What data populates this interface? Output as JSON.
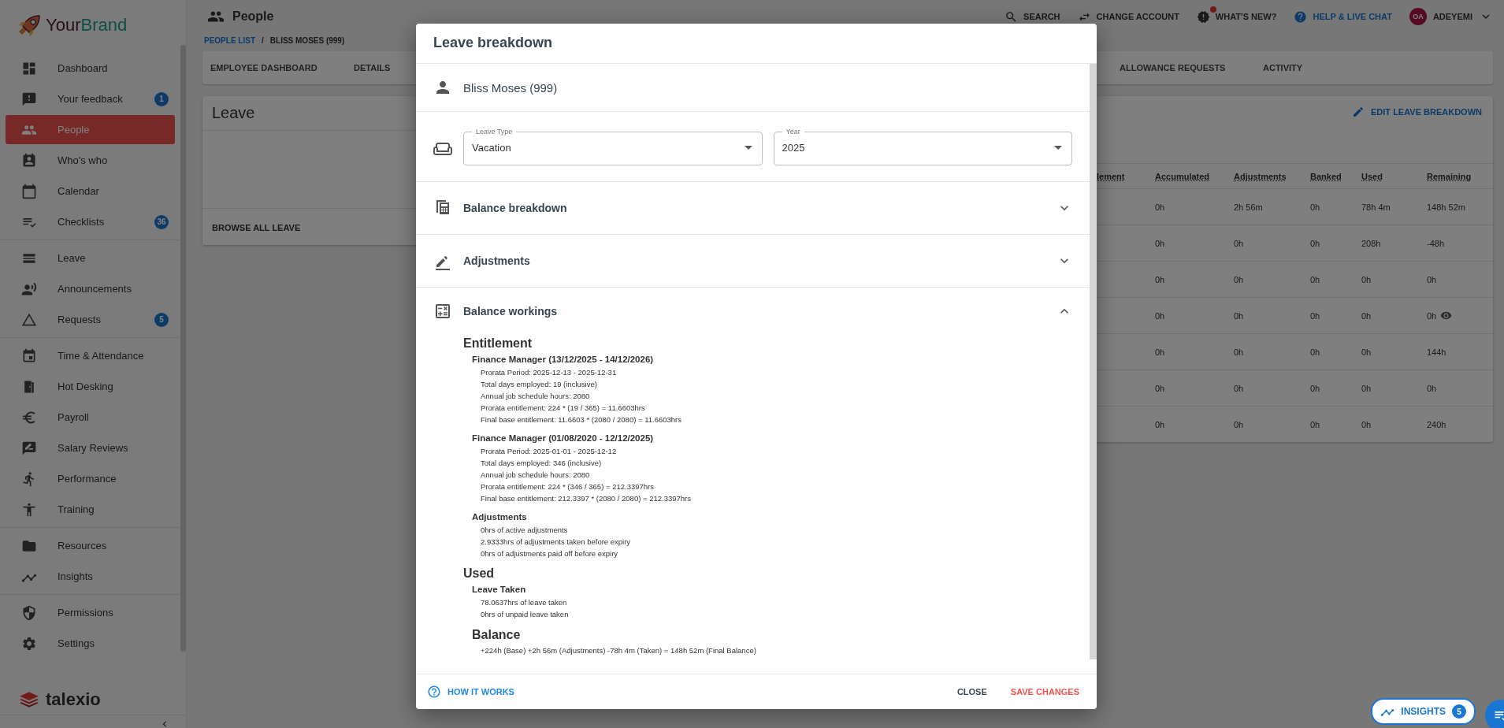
{
  "sidebar": {
    "brand": {
      "first": "Your",
      "second": "Brand"
    },
    "groups": [
      {
        "items": [
          {
            "label": "Dashboard",
            "selected": false
          },
          {
            "label": "Your feedback",
            "selected": false,
            "badge": "1"
          },
          {
            "label": "People",
            "selected": true
          },
          {
            "label": "Who's who",
            "selected": false
          },
          {
            "label": "Calendar",
            "selected": false
          },
          {
            "label": "Checklists",
            "selected": false,
            "badge": "36"
          }
        ]
      },
      {
        "items": [
          {
            "label": "Leave",
            "selected": false
          },
          {
            "label": "Announcements",
            "selected": false
          },
          {
            "label": "Requests",
            "selected": false,
            "badge": "5"
          }
        ]
      },
      {
        "items": [
          {
            "label": "Time & Attendance",
            "selected": false
          },
          {
            "label": "Hot Desking",
            "selected": false
          },
          {
            "label": "Payroll",
            "selected": false
          },
          {
            "label": "Salary Reviews",
            "selected": false
          },
          {
            "label": "Performance",
            "selected": false
          },
          {
            "label": "Training",
            "selected": false
          }
        ]
      },
      {
        "items": [
          {
            "label": "Resources",
            "selected": false
          },
          {
            "label": "Insights",
            "selected": false
          }
        ]
      },
      {
        "items": [
          {
            "label": "Permissions",
            "selected": false
          },
          {
            "label": "Settings",
            "selected": false
          }
        ]
      }
    ],
    "footer_logo": "talexio"
  },
  "header": {
    "title": "People",
    "actions": [
      {
        "label": "SEARCH",
        "kind": "plain",
        "notification": false
      },
      {
        "label": "CHANGE ACCOUNT",
        "kind": "plain",
        "notification": false
      },
      {
        "label": "WHAT'S NEW?",
        "kind": "plain",
        "notification": true
      },
      {
        "label": "HELP & LIVE CHAT",
        "kind": "highlight",
        "notification": false
      }
    ],
    "user": {
      "initials": "OA",
      "name": "ADEYEMI"
    }
  },
  "breadcrumb": {
    "separator": "/",
    "items": [
      {
        "label": "PEOPLE LIST",
        "link": true
      },
      {
        "label": "BLISS MOSES (999)",
        "link": false
      }
    ]
  },
  "tabs": [
    {
      "label": "EMPLOYEE DASHBOARD"
    },
    {
      "label": "DETAILS"
    },
    {
      "label": "ALLOWANCE REQUESTS"
    },
    {
      "label": "ACTIVITY"
    }
  ],
  "leave_card": {
    "title": "Leave",
    "footer_link": "BROWSE ALL LEAVE"
  },
  "balances_card": {
    "action": "EDIT LEAVE BREAKDOWN",
    "table": {
      "columns": [
        "lement",
        "Accumulated",
        "Adjustments",
        "Banked",
        "Used",
        "Remaining"
      ],
      "rows": [
        {
          "cells": [
            "",
            "0h",
            "2h 56m",
            "0h",
            "78h 4m",
            "148h 52m"
          ],
          "detail": false
        },
        {
          "cells": [
            "",
            "0h",
            "0h",
            "0h",
            "208h",
            "-48h"
          ],
          "detail": false
        },
        {
          "cells": [
            "",
            "0h",
            "0h",
            "0h",
            "0h",
            "0h"
          ],
          "detail": false
        },
        {
          "cells": [
            "",
            "0h",
            "0h",
            "0h",
            "0h",
            "0h"
          ],
          "detail": true
        },
        {
          "cells": [
            "",
            "0h",
            "0h",
            "0h",
            "0h",
            "144h"
          ],
          "detail": false
        },
        {
          "cells": [
            "",
            "0h",
            "0h",
            "0h",
            "0h",
            "0h"
          ],
          "detail": false
        },
        {
          "cells": [
            "",
            "0h",
            "0h",
            "0h",
            "0h",
            "240h"
          ],
          "detail": false
        }
      ]
    }
  },
  "modal": {
    "title": "Leave breakdown",
    "employee": "Bliss Moses (999)",
    "fields": [
      {
        "label": "Leave Type",
        "value": "Vacation"
      },
      {
        "label": "Year",
        "value": "2025"
      }
    ],
    "sections": [
      {
        "title": "Balance breakdown",
        "expanded": false
      },
      {
        "title": "Adjustments",
        "expanded": false
      },
      {
        "title": "Balance workings",
        "expanded": true,
        "content": {
          "blocks": [
            {
              "heading": "Entitlement",
              "groups": [
                {
                  "title": "Finance Manager (13/12/2025 - 14/12/2026)",
                  "lines": [
                    "Prorata Period: 2025-12-13 - 2025-12-31",
                    "Total days employed: 19 (inclusive)",
                    "Annual job schedule hours: 2080",
                    "Prorata entitlement: 224 * (19 / 365) = 11.6603hrs",
                    "Final base entitlement: 11.6603 * (2080 / 2080) = 11.6603hrs"
                  ]
                },
                {
                  "title": "Finance Manager (01/08/2020 - 12/12/2025)",
                  "lines": [
                    "Prorata Period: 2025-01-01 - 2025-12-12",
                    "Total days employed: 346 (inclusive)",
                    "Annual job schedule hours: 2080",
                    "Prorata entitlement: 224 * (346 / 365) = 212.3397hrs",
                    "Final base entitlement: 212.3397 * (2080 / 2080) = 212.3397hrs"
                  ]
                },
                {
                  "title": "Adjustments",
                  "lines": [
                    "0hrs of active adjustments",
                    "2.9333hrs of adjustments taken before expiry",
                    "0hrs of adjustments paid off before expiry"
                  ]
                }
              ]
            },
            {
              "heading": "Used",
              "groups": [
                {
                  "title": "Leave Taken",
                  "lines": [
                    "78.0637hrs of leave taken",
                    "0hrs of unpaid leave taken"
                  ]
                }
              ]
            }
          ],
          "balance": {
            "heading": "Balance",
            "formula": "+224h (Base) +2h 56m (Adjustments) -78h 4m (Taken) = 148h 52m (Final Balance)"
          }
        }
      }
    ],
    "footer": {
      "help": "HOW IT WORKS",
      "close": "CLOSE",
      "save": "SAVE CHANGES"
    }
  },
  "insights_button": {
    "label": "INSIGHTS",
    "badge": "5"
  }
}
